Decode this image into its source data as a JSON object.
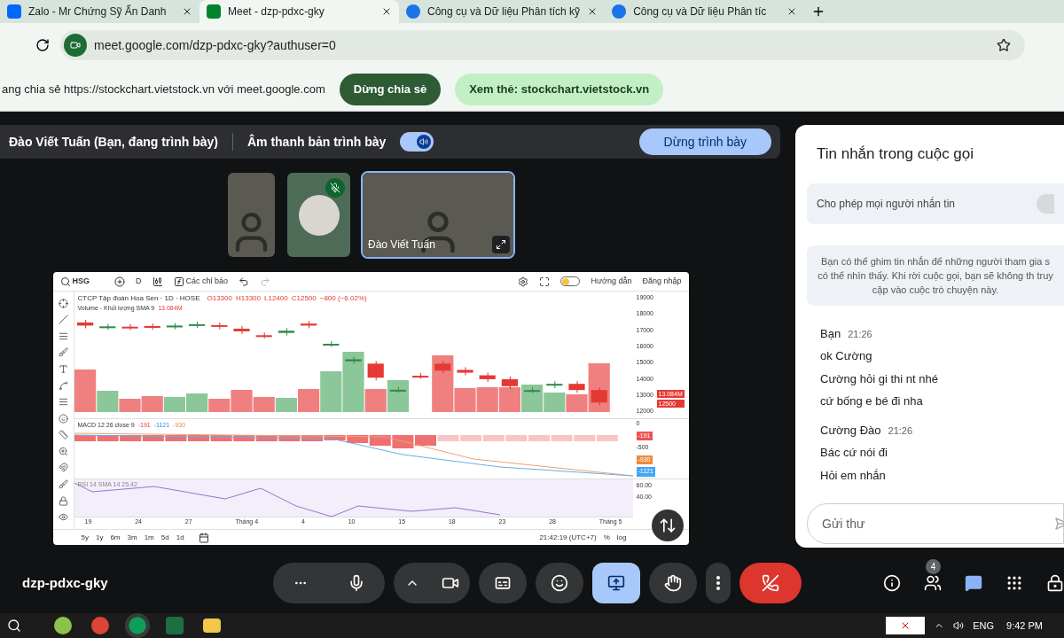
{
  "browser": {
    "tabs": [
      {
        "title": "Zalo - Mr Chứng Sỹ Ẩn Danh",
        "kind": "zalo",
        "selected": false
      },
      {
        "title": "Meet - dzp-pdxc-gky",
        "kind": "meet",
        "selected": true
      },
      {
        "title": "Công cụ và Dữ liệu Phân tích kỹ",
        "kind": "web",
        "selected": false
      },
      {
        "title": "Công cụ và Dữ liệu Phân tíc",
        "kind": "web",
        "selected": false
      }
    ],
    "address": "meet.google.com/dzp-pdxc-gky?authuser=0"
  },
  "share_bar": {
    "message": "ang chia sẻ https://stockchart.vietstock.vn với meet.google.com",
    "stop_button": "Dừng chia sẻ",
    "view_button": "Xem thẻ: stockchart.vietstock.vn"
  },
  "presenting_bar": {
    "presenter": "Đào Viết Tuấn (Bạn, đang trình bày)",
    "audio_label": "Âm thanh bản trình bày",
    "audio_on": true,
    "stop_button": "Dừng trình bày"
  },
  "tiles": [
    {
      "kind": "video",
      "muted": false,
      "selected": false
    },
    {
      "kind": "avatar",
      "muted": true,
      "selected": false
    },
    {
      "kind": "video",
      "name": "Đào Viết Tuấn",
      "muted": false,
      "selected": true
    }
  ],
  "chart": {
    "symbol": "HSG",
    "interval": "D",
    "indicators": "Các chỉ báo",
    "guide": "Hướng dẫn",
    "login": "Đăng nhập",
    "dark_mode": false,
    "title": "CTCP Tập đoàn Hoa Sen · 1D · HOSE",
    "ohlc": [
      "O13300",
      "H13300",
      "L12400",
      "C12500",
      "−800 (−6.02%)"
    ],
    "volume_label": "Volume - Khối lượng SMA 9",
    "volume_value": "13.084M",
    "macd_label": "MACD 12 26 close 9",
    "macd_values": [
      "-191",
      "-1121",
      "-930"
    ],
    "rsi_label": "RSI 14 SMA 14",
    "rsi_value": "25.42",
    "price_ticks": [
      "19000",
      "18000",
      "17000",
      "16000",
      "15000",
      "14000",
      "13000",
      "12000"
    ],
    "macd_ticks": [
      "0",
      "-500"
    ],
    "rsi_ticks": [
      "60.00",
      "40.00"
    ],
    "price_tags": [
      {
        "text": "13.084M",
        "color": "#e53935"
      },
      {
        "text": "12500",
        "color": "#e53935"
      }
    ],
    "macd_tags": [
      {
        "text": "-191",
        "color": "#ef5350"
      },
      {
        "text": "-930",
        "color": "#f08a3c"
      },
      {
        "text": "-1121",
        "color": "#42a5f5"
      }
    ],
    "x_labels": [
      "19",
      "24",
      "27",
      "Tháng 4",
      "4",
      "10",
      "15",
      "18",
      "23",
      "28",
      "Tháng 5"
    ],
    "ranges": [
      "5y",
      "1y",
      "6m",
      "3m",
      "1m",
      "5d",
      "1d"
    ],
    "clock": "21:42:19 (UTC+7)",
    "percent": "%",
    "log": "log"
  },
  "chat": {
    "title": "Tin nhắn trong cuộc gọi",
    "allow_label": "Cho phép mọi người nhắn tin",
    "allow_on": false,
    "notice": "Bạn có thể ghim tin nhắn để những người tham gia s có thể nhìn thấy. Khi rời cuộc gọi, bạn sẽ không th truy cập vào cuộc trò chuyện này.",
    "messages": [
      {
        "sender": "Bạn",
        "time": "21:26",
        "lines": [
          "ok Cường",
          "Cường hỏi gi thi nt nhé",
          "cứ bống e bé đi nha"
        ]
      },
      {
        "sender": "Cường Đào",
        "time": "21:26",
        "lines": [
          "Bác cứ nói đi",
          "Hỏi em nhắn"
        ]
      }
    ],
    "placeholder": "Gửi thư"
  },
  "bottom_bar": {
    "meeting_code": "dzp-pdxc-gky",
    "people_count": "4"
  },
  "taskbar": {
    "language": "ENG",
    "time": "9:42 PM"
  }
}
